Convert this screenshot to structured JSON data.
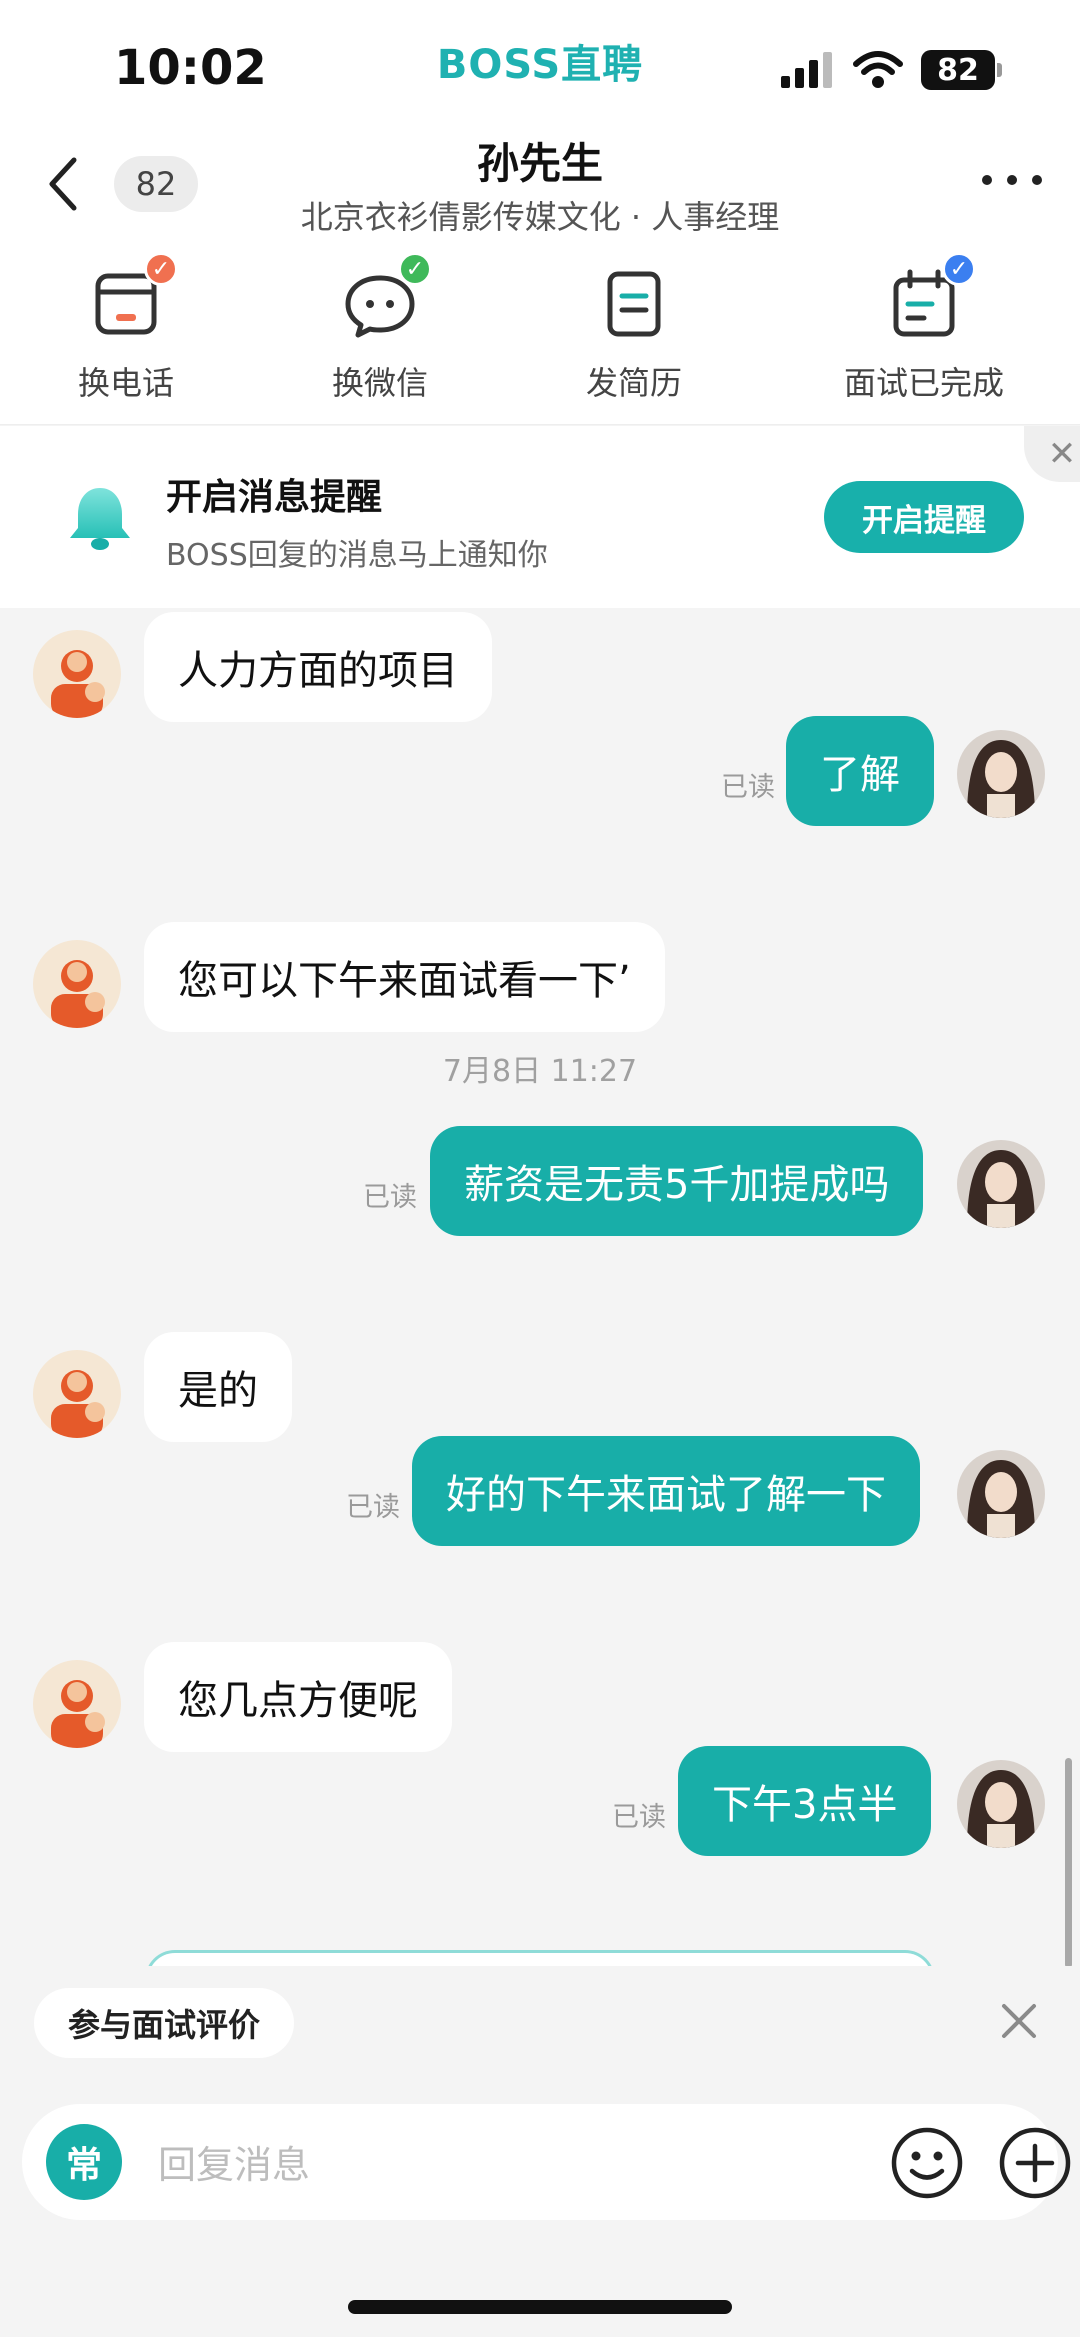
{
  "status_bar": {
    "time": "10:02",
    "brand": "BOSS直聘",
    "battery": "82"
  },
  "header": {
    "unread_count": "82",
    "name": "孙先生",
    "subtitle": "北京衣衫倩影传媒文化 · 人事经理"
  },
  "actions": [
    {
      "label": "换电话",
      "icon": "phone-swap-icon"
    },
    {
      "label": "换微信",
      "icon": "wechat-swap-icon"
    },
    {
      "label": "发简历",
      "icon": "resume-icon"
    },
    {
      "label": "面试已完成",
      "icon": "interview-calendar-icon"
    }
  ],
  "notify": {
    "title": "开启消息提醒",
    "desc": "BOSS回复的消息马上通知你",
    "button": "开启提醒"
  },
  "messages": [
    {
      "from": "boss",
      "text": "人力方面的项目"
    },
    {
      "from": "me",
      "text": "了解",
      "status": "已读"
    },
    {
      "from": "boss",
      "text": "您可以下午来面试看一下’"
    },
    {
      "timestamp": "7月8日 11:27"
    },
    {
      "from": "me",
      "text": "薪资是无责5千加提成吗",
      "status": "已读"
    },
    {
      "from": "boss",
      "text": "是的"
    },
    {
      "from": "me",
      "text": "好的下午来面试了解一下",
      "status": "已读"
    },
    {
      "from": "boss",
      "text": "您几点方便呢"
    },
    {
      "from": "me",
      "text": "下午3点半",
      "status": "已读"
    }
  ],
  "eval_chip": "参与面试评价",
  "input": {
    "quick_label": "常",
    "placeholder": "回复消息"
  },
  "colors": {
    "accent": "#18aea8",
    "brand": "#1fb1b1"
  }
}
